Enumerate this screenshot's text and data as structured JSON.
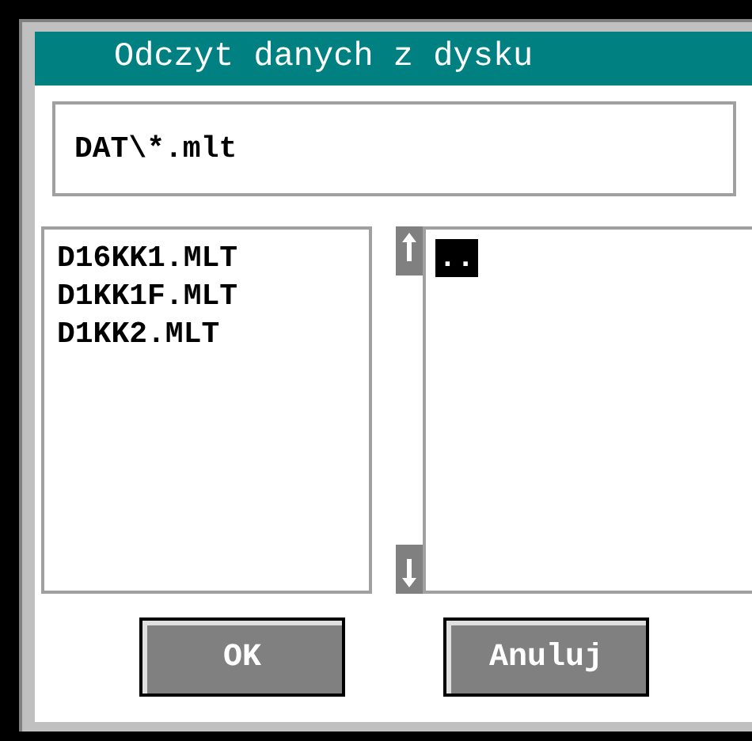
{
  "window": {
    "title": "Odczyt danych z dysku"
  },
  "path_field": {
    "value": "DAT\\*.mlt"
  },
  "files": [
    {
      "label": "D16KK1.MLT",
      "selected": false
    },
    {
      "label": "D1KK1F.MLT",
      "selected": false
    },
    {
      "label": "D1KK2.MLT",
      "selected": false
    }
  ],
  "directories": [
    {
      "label": "..",
      "selected": true
    }
  ],
  "buttons": [
    {
      "label": "OK"
    },
    {
      "label": "Anuluj"
    }
  ]
}
